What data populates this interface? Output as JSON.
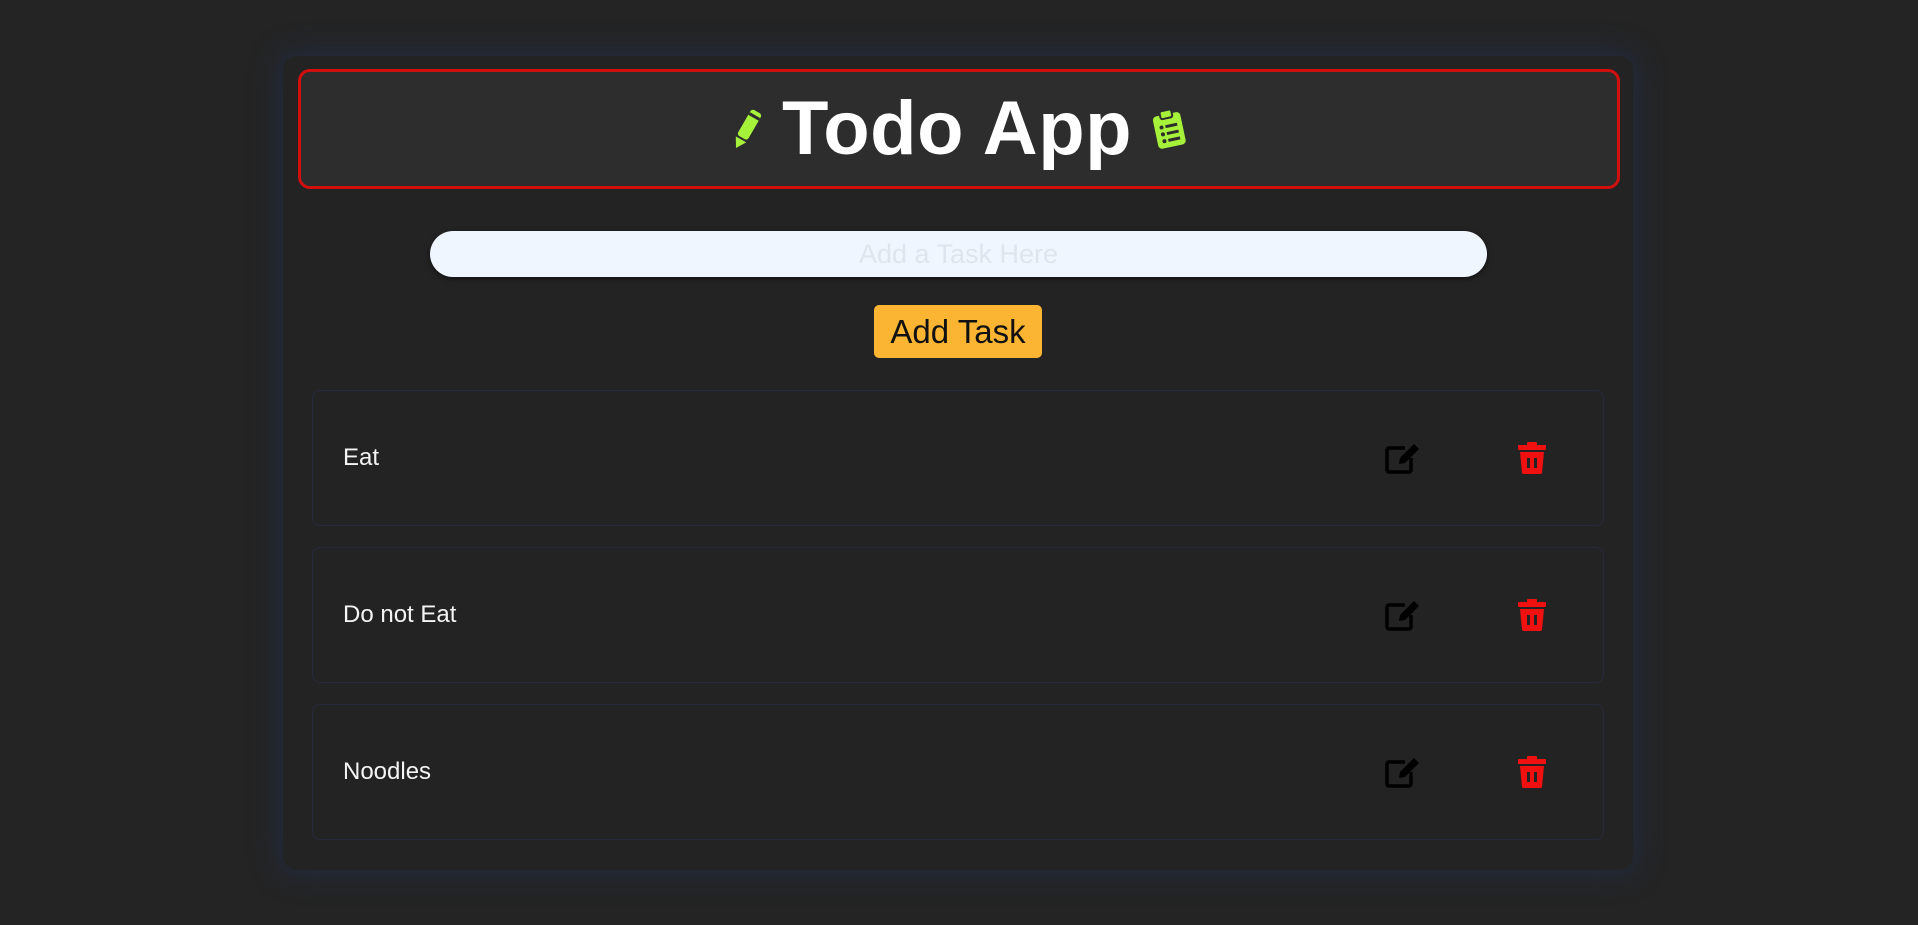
{
  "header": {
    "title": "Todo App",
    "left_icon": "pencil-icon",
    "right_icon": "clipboard-list-icon",
    "icon_color": "#a6f23a",
    "border_color": "#d10f0f"
  },
  "input": {
    "placeholder": "Add a Task Here",
    "value": ""
  },
  "add_button": {
    "label": "Add Task",
    "color": "#fcb533"
  },
  "tasks": [
    {
      "text": "Eat",
      "edit_icon": "edit-icon",
      "delete_icon": "trash-icon"
    },
    {
      "text": "Do not Eat",
      "edit_icon": "edit-icon",
      "delete_icon": "trash-icon"
    },
    {
      "text": "Noodles",
      "edit_icon": "edit-icon",
      "delete_icon": "trash-icon"
    }
  ],
  "colors": {
    "background": "#242424",
    "delete": "#f01010",
    "edit": "#000000"
  }
}
